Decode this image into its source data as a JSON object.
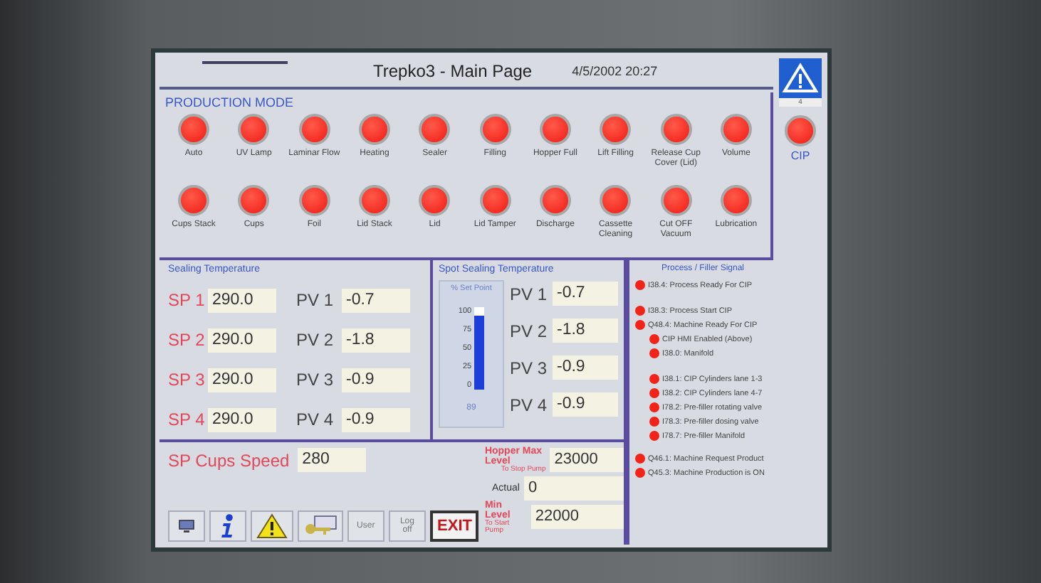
{
  "header": {
    "title": "Trepko3 - Main Page",
    "datetime": "4/5/2002 20:27",
    "alarm_count": "4"
  },
  "production_mode": {
    "title": "PRODUCTION MODE",
    "rows": [
      [
        {
          "label": "Auto",
          "on": true
        },
        {
          "label": "UV Lamp",
          "on": true
        },
        {
          "label": "Laminar Flow",
          "on": true
        },
        {
          "label": "Heating",
          "on": true
        },
        {
          "label": "Sealer",
          "on": true
        },
        {
          "label": "Filling",
          "on": true
        },
        {
          "label": "Hopper Full",
          "on": true
        },
        {
          "label": "Lift Filling",
          "on": true
        },
        {
          "label": "Release Cup Cover (Lid)",
          "on": true
        },
        {
          "label": "Volume",
          "on": true
        }
      ],
      [
        {
          "label": "Cups Stack",
          "on": true
        },
        {
          "label": "Cups",
          "on": true
        },
        {
          "label": "Foil",
          "on": true
        },
        {
          "label": "Lid Stack",
          "on": true
        },
        {
          "label": "Lid",
          "on": true
        },
        {
          "label": "Lid Tamper",
          "on": true
        },
        {
          "label": "Discharge",
          "on": true
        },
        {
          "label": "Cassette Cleaning",
          "on": true
        },
        {
          "label": "Cut OFF Vacuum",
          "on": true
        },
        {
          "label": "Lubrication",
          "on": true
        }
      ]
    ]
  },
  "cip": {
    "label": "CIP",
    "on": true
  },
  "sealing": {
    "title": "Sealing Temperature",
    "rows": [
      {
        "sp_label": "SP 1",
        "sp": "290.0",
        "pv_label": "PV 1",
        "pv": "-0.7"
      },
      {
        "sp_label": "SP 2",
        "sp": "290.0",
        "pv_label": "PV 2",
        "pv": "-1.8"
      },
      {
        "sp_label": "SP 3",
        "sp": "290.0",
        "pv_label": "PV 3",
        "pv": "-0.9"
      },
      {
        "sp_label": "SP 4",
        "sp": "290.0",
        "pv_label": "PV 4",
        "pv": "-0.9"
      }
    ]
  },
  "spot_sealing": {
    "title": "Spot Sealing Temperature",
    "gauge": {
      "title": "% Set Point",
      "ticks": [
        "100",
        "75",
        "50",
        "25",
        "0"
      ],
      "level": 0.89,
      "reading": "89"
    },
    "rows": [
      {
        "label": "PV 1",
        "value": "-0.7"
      },
      {
        "label": "PV 2",
        "value": "-1.8"
      },
      {
        "label": "PV 3",
        "value": "-0.9"
      },
      {
        "label": "PV 4",
        "value": "-0.9"
      }
    ]
  },
  "signals": {
    "title": "Process / Filler Signal",
    "items": [
      {
        "label": "I38.4: Process Ready For CIP",
        "on": true
      },
      {
        "label": "I38.3: Process Start CIP",
        "on": true
      },
      {
        "label": "Q48.4: Machine Ready For CIP",
        "on": true,
        "children": [
          {
            "label": "CIP HMI Enabled (Above)",
            "on": true
          },
          {
            "label": "I38.0: Manifold",
            "on": true
          },
          {
            "label": "I38.1: CIP Cylinders lane 1-3",
            "on": true
          },
          {
            "label": "I38.2: CIP Cylinders lane 4-7",
            "on": true
          },
          {
            "label": "I78.2: Pre-filler rotating valve",
            "on": true
          },
          {
            "label": "I78.3: Pre-filler dosing valve",
            "on": true
          },
          {
            "label": "I78.7: Pre-filler Manifold",
            "on": true
          }
        ]
      },
      {
        "label": "Q46.1: Machine Request Product",
        "on": true
      },
      {
        "label": "Q45.3: Machine Production is ON",
        "on": true
      }
    ]
  },
  "cups_speed": {
    "label": "SP Cups Speed",
    "value": "280"
  },
  "levels": [
    {
      "label": "Hopper Max Level",
      "sublabel": "To Stop Pump",
      "value": "23000"
    },
    {
      "label": "Actual",
      "value": "0"
    },
    {
      "label": "Min Level",
      "sublabel": "To Start Pump",
      "value": "22000"
    }
  ],
  "toolbar": [
    {
      "kind": "screen"
    },
    {
      "kind": "info"
    },
    {
      "kind": "warning"
    },
    {
      "kind": "keys"
    },
    {
      "kind": "text",
      "label": "User"
    },
    {
      "kind": "text",
      "label": "Log off"
    },
    {
      "kind": "exit",
      "label": "EXIT"
    }
  ]
}
